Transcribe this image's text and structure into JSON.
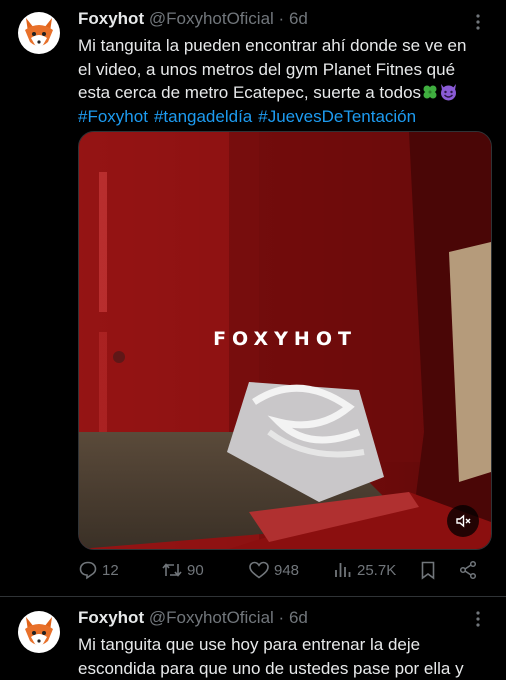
{
  "tweets": [
    {
      "author_name": "Foxyhot",
      "author_handle": "@FoxyhotOficial",
      "separator": "·",
      "time": "6d",
      "text_lines": [
        "Mi tanguita la pueden encontrar ahí donde se ve en",
        "el video, a unos metros del gym Planet Fitnes qué",
        "esta cerca de metro Ecatepec, suerte a todos"
      ],
      "hashtags": [
        "#Foxyhot",
        "#tangadeldía",
        "#JuevesDeTentación"
      ],
      "media_watermark": "FOXYHOT",
      "stats": {
        "replies": "12",
        "reposts": "90",
        "likes": "948",
        "views": "25.7K"
      }
    },
    {
      "author_name": "Foxyhot",
      "author_handle": "@FoxyhotOficial",
      "separator": "·",
      "time": "6d",
      "text_lines": [
        "Mi tanguita que use hoy para entrenar la deje",
        "escondida para que uno de ustedes pase por ella y"
      ]
    }
  ],
  "icons": {
    "more": "more-dots-icon",
    "reply": "reply-icon",
    "repost": "repost-icon",
    "like": "heart-icon",
    "views": "views-icon",
    "bookmark": "bookmark-icon",
    "share": "share-icon",
    "mute": "muted-speaker-icon"
  },
  "colors": {
    "background": "#000000",
    "text": "#e7e9ea",
    "secondary": "#71767b",
    "link": "#1d9bf0",
    "divider": "#2f3336"
  }
}
